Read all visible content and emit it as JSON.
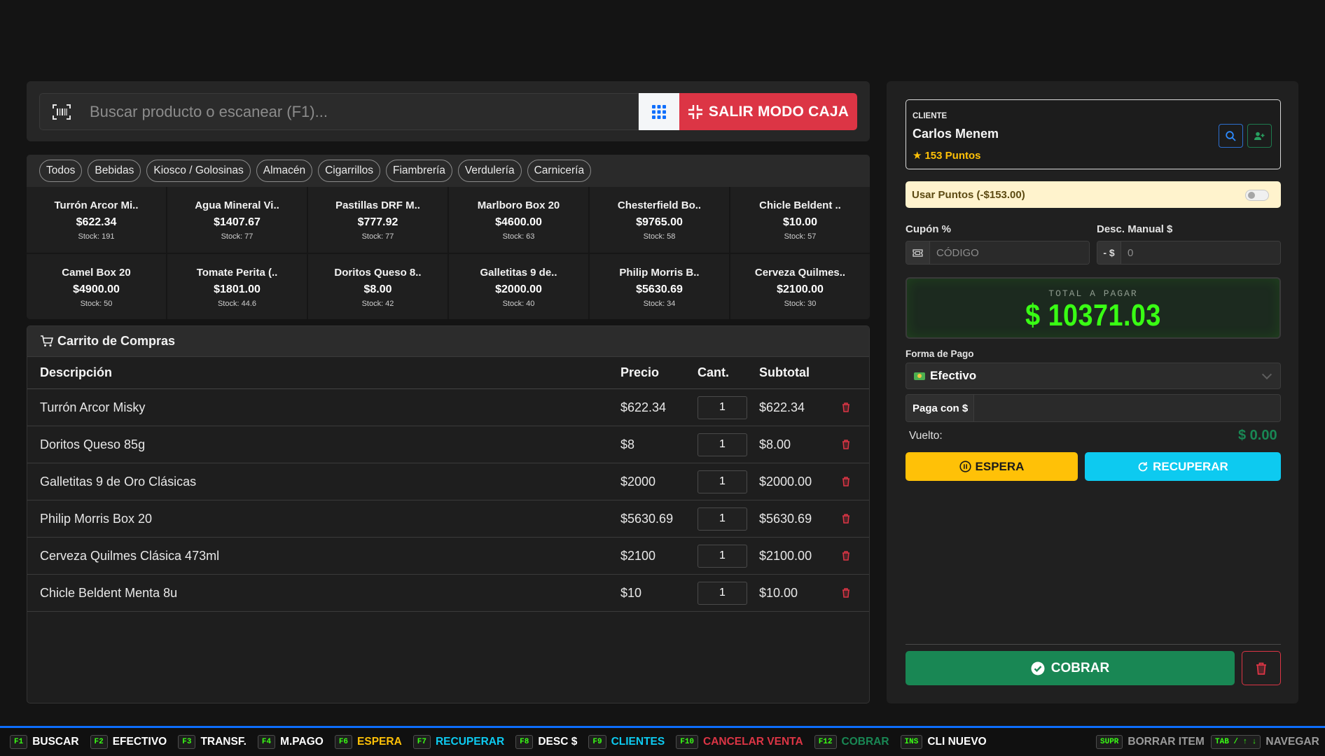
{
  "search": {
    "placeholder": "Buscar producto o escanear (F1)...",
    "exit_label": "SALIR MODO CAJA"
  },
  "categories": [
    "Todos",
    "Bebidas",
    "Kiosco / Golosinas",
    "Almacén",
    "Cigarrillos",
    "Fiambrería",
    "Verdulería",
    "Carnicería"
  ],
  "products": [
    {
      "name": "Turrón Arcor Mi..",
      "price": "$622.34",
      "stock": "Stock: 191"
    },
    {
      "name": "Agua Mineral Vi..",
      "price": "$1407.67",
      "stock": "Stock: 77"
    },
    {
      "name": "Pastillas DRF M..",
      "price": "$777.92",
      "stock": "Stock: 77"
    },
    {
      "name": "Marlboro Box 20",
      "price": "$4600.00",
      "stock": "Stock: 63"
    },
    {
      "name": "Chesterfield Bo..",
      "price": "$9765.00",
      "stock": "Stock: 58"
    },
    {
      "name": "Chicle Beldent ..",
      "price": "$10.00",
      "stock": "Stock: 57"
    },
    {
      "name": "Camel Box 20",
      "price": "$4900.00",
      "stock": "Stock: 50"
    },
    {
      "name": "Tomate Perita (..",
      "price": "$1801.00",
      "stock": "Stock: 44.6"
    },
    {
      "name": "Doritos Queso 8..",
      "price": "$8.00",
      "stock": "Stock: 42"
    },
    {
      "name": "Galletitas 9 de..",
      "price": "$2000.00",
      "stock": "Stock: 40"
    },
    {
      "name": "Philip Morris B..",
      "price": "$5630.69",
      "stock": "Stock: 34"
    },
    {
      "name": "Cerveza Quilmes..",
      "price": "$2100.00",
      "stock": "Stock: 30"
    }
  ],
  "cart": {
    "title": "Carrito de Compras",
    "columns": {
      "desc": "Descripción",
      "price": "Precio",
      "qty": "Cant.",
      "subtotal": "Subtotal"
    },
    "rows": [
      {
        "desc": "Turrón Arcor Misky",
        "price": "$622.34",
        "qty": "1",
        "subtotal": "$622.34"
      },
      {
        "desc": "Doritos Queso 85g",
        "price": "$8",
        "qty": "1",
        "subtotal": "$8.00"
      },
      {
        "desc": "Galletitas 9 de Oro Clásicas",
        "price": "$2000",
        "qty": "1",
        "subtotal": "$2000.00"
      },
      {
        "desc": "Philip Morris Box 20",
        "price": "$5630.69",
        "qty": "1",
        "subtotal": "$5630.69"
      },
      {
        "desc": "Cerveza Quilmes Clásica 473ml",
        "price": "$2100",
        "qty": "1",
        "subtotal": "$2100.00"
      },
      {
        "desc": "Chicle Beldent Menta 8u",
        "price": "$10",
        "qty": "1",
        "subtotal": "$10.00"
      }
    ]
  },
  "client": {
    "label": "CLIENTE",
    "name": "Carlos Menem",
    "points": "153 Puntos"
  },
  "points_toggle": {
    "label": "Usar Puntos (-$153.00)",
    "enabled": false
  },
  "coupon": {
    "label": "Cupón %",
    "placeholder": "CÓDIGO"
  },
  "manual_discount": {
    "label": "Desc. Manual $",
    "prefix": "- $",
    "placeholder": "0"
  },
  "total": {
    "label": "TOTAL A PAGAR",
    "value": "$ 10371.03"
  },
  "payment": {
    "label": "Forma de Pago",
    "selected": "Efectivo",
    "icon": "cash-icon"
  },
  "pay_with": {
    "label": "Paga con $",
    "value": ""
  },
  "change": {
    "label": "Vuelto:",
    "value": "$ 0.00"
  },
  "buttons": {
    "espera": "ESPERA",
    "recuperar": "RECUPERAR",
    "cobrar": "COBRAR"
  },
  "shortcuts": [
    {
      "key": "F1",
      "label": "BUSCAR",
      "color": "#ffffff"
    },
    {
      "key": "F2",
      "label": "EFECTIVO",
      "color": "#ffffff"
    },
    {
      "key": "F3",
      "label": "TRANSF.",
      "color": "#ffffff"
    },
    {
      "key": "F4",
      "label": "M.PAGO",
      "color": "#ffffff"
    },
    {
      "key": "F6",
      "label": "ESPERA",
      "color": "#ffc107"
    },
    {
      "key": "F7",
      "label": "RECUPERAR",
      "color": "#0dcaf0"
    },
    {
      "key": "F8",
      "label": "DESC $",
      "color": "#ffffff"
    },
    {
      "key": "F9",
      "label": "CLIENTES",
      "color": "#0dcaf0"
    },
    {
      "key": "F10",
      "label": "CANCELAR VENTA",
      "color": "#dc3545"
    },
    {
      "key": "F12",
      "label": "COBRAR",
      "color": "#198754"
    },
    {
      "key": "INS",
      "label": "CLI NUEVO",
      "color": "#ffffff"
    }
  ],
  "shortcuts_right": [
    {
      "key": "SUPR",
      "label": "BORRAR ITEM"
    },
    {
      "key": "TAB / ↑ ↓",
      "label": "NAVEGAR"
    }
  ],
  "colors": {
    "accent_red": "#dc3545",
    "accent_green": "#198754",
    "total_green": "#39ff14",
    "warning": "#ffc107",
    "info": "#0dcaf0",
    "footer_border": "#0d6efd"
  }
}
